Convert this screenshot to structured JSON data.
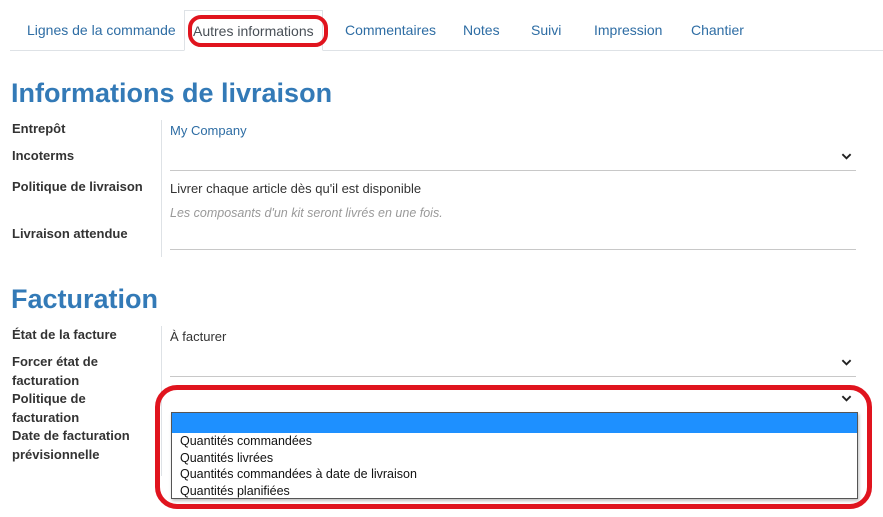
{
  "tabs": [
    {
      "label": "Lignes de la commande"
    },
    {
      "label": "Autres informations"
    },
    {
      "label": "Commentaires"
    },
    {
      "label": "Notes"
    },
    {
      "label": "Suivi"
    },
    {
      "label": "Impression"
    },
    {
      "label": "Chantier"
    }
  ],
  "delivery": {
    "title": "Informations de livraison",
    "warehouse_label": "Entrepôt",
    "warehouse_value": "My Company",
    "incoterms_label": "Incoterms",
    "policy_label": "Politique de livraison",
    "policy_value": "Livrer chaque article dès qu'il est disponible",
    "policy_hint": "Les composants d'un kit seront livrés en une fois.",
    "expected_label": "Livraison attendue"
  },
  "billing": {
    "title": "Facturation",
    "state_label": "État de la facture",
    "state_value": "À facturer",
    "force_label_1": "Forcer état de",
    "force_label_2": "facturation",
    "policy_label_1": "Politique de",
    "policy_label_2": "facturation",
    "date_label_1": "Date de facturation",
    "date_label_2": "prévisionnelle",
    "policy_options": [
      "Quantités commandées",
      "Quantités livrées",
      "Quantités commandées à date de livraison",
      "Quantités planifiées"
    ]
  },
  "colors": {
    "link": "#2e6da4",
    "heading": "#337ab7",
    "selected_option": "#1e90ff",
    "annotation_red": "#e0141e"
  }
}
